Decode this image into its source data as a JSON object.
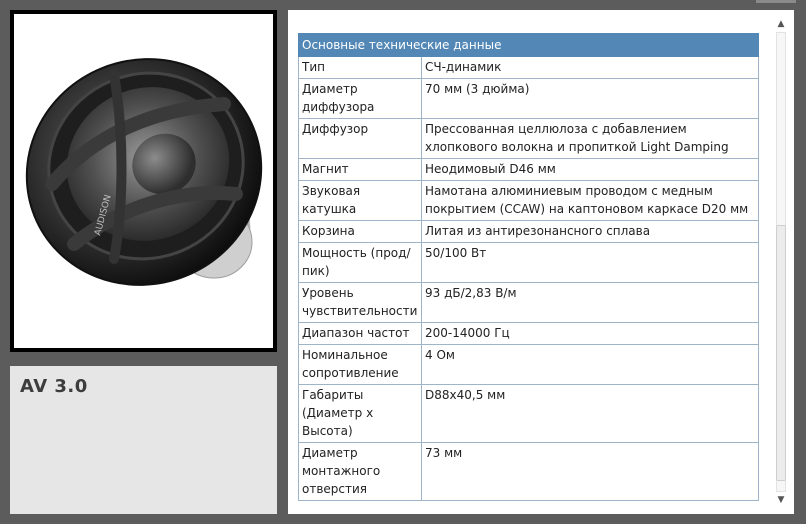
{
  "product": {
    "name": "AV 3.0",
    "image_alt": "midrange speaker",
    "brand_mark": "AUDISON"
  },
  "specs": {
    "header": "Основные технические данные",
    "rows": [
      {
        "label": "Тип",
        "value": "СЧ-динамик"
      },
      {
        "label": "Диаметр диффузора",
        "value": "70 мм (3 дюйма)"
      },
      {
        "label": "Диффузор",
        "value": "Прессованная целлюлоза с добавлением хлопкового волокна и пропиткой Light Damping"
      },
      {
        "label": "Магнит",
        "value": "Неодимовый D46 мм"
      },
      {
        "label": "Звуковая катушка",
        "value": "Намотана алюминиевым проводом с медным покрытием (CCAW) на каптоновом каркасе D20 мм"
      },
      {
        "label": "Корзина",
        "value": "Литая из антирезонансного сплава"
      },
      {
        "label": "Мощность (прод/пик)",
        "value": "50/100 Вт"
      },
      {
        "label": "Уровень чувствительности",
        "value": "93 дБ/2,83 В/м"
      },
      {
        "label": "Диапазон частот",
        "value": "200-14000 Гц"
      },
      {
        "label": "Номинальное сопротивление",
        "value": "4 Ом"
      },
      {
        "label": "Габариты (Диаметр х Высота)",
        "value": "D88x40,5 мм"
      },
      {
        "label": "Диаметр монтажного отверстия",
        "value": "73 мм"
      }
    ]
  },
  "scrollbar": {
    "up_icon": "scroll-up-arrow",
    "down_icon": "scroll-down-arrow"
  }
}
